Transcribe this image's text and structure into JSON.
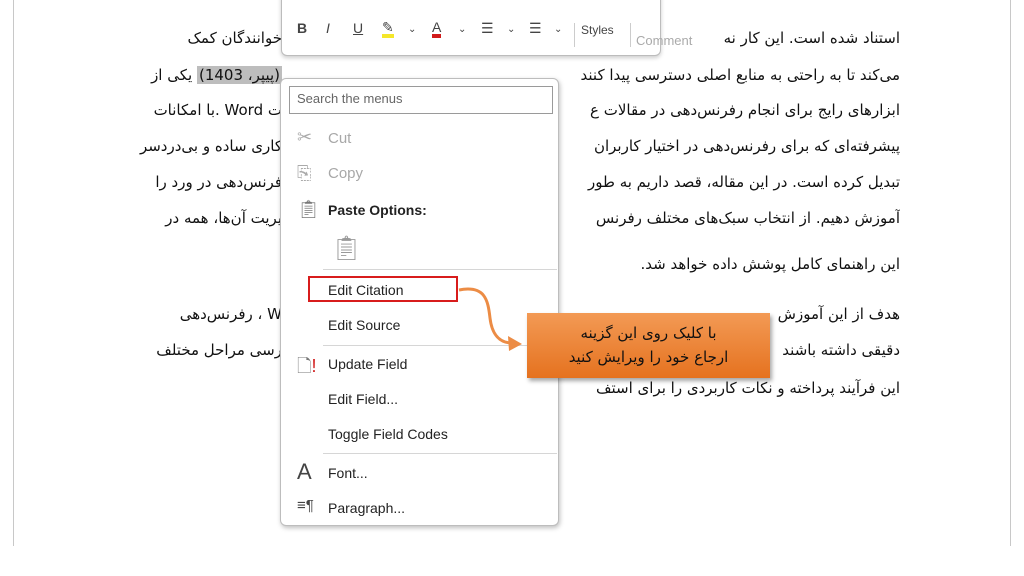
{
  "document": {
    "lines_right": [
      "استناد شده است. این کار نه",
      "می‌کند تا به راحتی به منابع اصلی دسترسی پیدا کنند",
      "ابزارهای رایج برای انجام رفرنس‌دهی در مقالات ع",
      "پیشرفته‌ای که برای رفرنس‌دهی در اختیار کاربران",
      "تبدیل کرده است. در این مقاله، قصد داریم به طور",
      "آموزش دهیم. از انتخاب سبک‌های مختلف رفرنس",
      "این راهنمای کامل پوشش داده خواهد شد.",
      "هدف از این آموزش",
      "دقیقی داشته باشند",
      "این فرآیند پرداخته و نکات کاربردی را برای استف"
    ],
    "lines_left": [
      "خوانندگان کمک",
      "یکی از",
      "ت Word .با امکانات",
      "کاری ساده و بی‌دردسر",
      "فرنس‌دهی در ورد را",
      "یریت آن‌ها، همه در",
      "W ، رفرنس‌دهی",
      "رسی مراحل مختلف"
    ],
    "citation": "(پیپر، 1403)"
  },
  "toolbar": {
    "bold": "B",
    "italic": "I",
    "underline": "U",
    "highlight_color": "#f5e72a",
    "font_color": "#d11a1a",
    "styles": "Styles",
    "comment": "Comment"
  },
  "context_menu": {
    "search_placeholder": "Search the menus",
    "cut": "Cut",
    "copy": "Copy",
    "paste_options": "Paste Options:",
    "edit_citation": "Edit Citation",
    "edit_source": "Edit Source",
    "update_field": "Update Field",
    "edit_field": "Edit Field...",
    "toggle_field_codes": "Toggle Field Codes",
    "font": "Font...",
    "paragraph": "Paragraph..."
  },
  "callout": {
    "line1": "با کلیک روی این گزینه",
    "line2": "ارجاع خود را ویرایش کنید",
    "color": "#ec8033"
  },
  "highlight_box_color": "#d81c1c"
}
